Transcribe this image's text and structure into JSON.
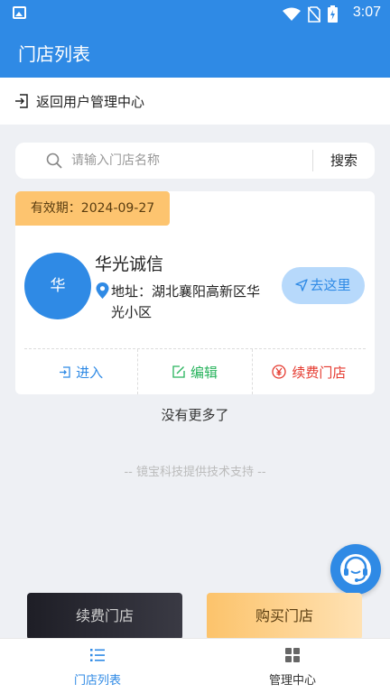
{
  "status_bar": {
    "time": "3:07",
    "icons": [
      "image-icon",
      "wifi-icon",
      "no-sim-icon",
      "battery-charging-icon"
    ]
  },
  "header": {
    "title": "门店列表"
  },
  "back_link": {
    "label": "返回用户管理中心",
    "icon": "exit-icon"
  },
  "search": {
    "placeholder": "请输入门店名称",
    "value": "",
    "button_label": "搜索",
    "icon": "search-icon"
  },
  "store_card": {
    "validity": "有效期：2024-09-27",
    "avatar_text": "华",
    "name": "华光诚信",
    "address_label": "地址：",
    "address": "湖北襄阳高新区华光小区",
    "goto_label": "去这里",
    "actions": [
      {
        "label": "进入",
        "icon": "enter-icon",
        "color": "#2f8ae5"
      },
      {
        "label": "编辑",
        "icon": "edit-icon",
        "color": "#27b35c"
      },
      {
        "label": "续费门店",
        "icon": "yen-icon",
        "color": "#e53a2f"
      }
    ]
  },
  "list_end_text": "没有更多了",
  "support_text": "-- 镜宝科技提供技术支持 --",
  "floating_button": {
    "icon": "customer-service-icon"
  },
  "bottom_buttons": {
    "renew_label": "续费门店",
    "buy_label": "购买门店"
  },
  "tabs": [
    {
      "label": "门店列表",
      "icon": "list-icon",
      "active": true
    },
    {
      "label": "管理中心",
      "icon": "grid-icon",
      "active": false
    }
  ],
  "colors": {
    "primary": "#2f8ae5",
    "gold": "#fdc46f",
    "success": "#27b35c",
    "danger": "#e53a2f"
  }
}
